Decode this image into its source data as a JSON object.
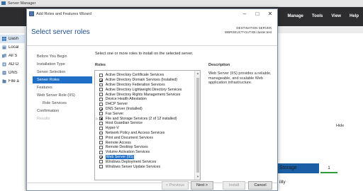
{
  "server_manager": {
    "title": "Server Manager",
    "menu": [
      "Manage",
      "Tools",
      "View",
      "Help"
    ],
    "sidebar": [
      {
        "label": "Dash",
        "icon": "dashboard-icon",
        "active": true
      },
      {
        "label": "Local",
        "icon": "server-icon"
      },
      {
        "label": "All S",
        "icon": "servers-icon"
      },
      {
        "label": "AD D",
        "icon": "ad-icon"
      },
      {
        "label": "DNS",
        "icon": "dns-icon"
      },
      {
        "label": "File a",
        "icon": "folder-icon"
      }
    ],
    "hide_label": "Hide",
    "storage_label": "Storage",
    "storage_count": "1",
    "lity_label": "ility"
  },
  "wizard": {
    "title": "Add Roles and Features Wizard",
    "heading": "Select server roles",
    "destination_label": "DESTINATION SERVER",
    "destination_server": "WBRSEUCTY1UTXB.cluster.test",
    "intro": "Select one or more roles to install on the selected server.",
    "roles_label": "Roles",
    "description_label": "Description",
    "description_text": "Web Server (IIS) provides a reliable, manageable, and scalable Web application infrastructure.",
    "nav": [
      {
        "label": "Before You Begin",
        "state": "normal"
      },
      {
        "label": "Installation Type",
        "state": "normal"
      },
      {
        "label": "Server Selection",
        "state": "normal"
      },
      {
        "label": "Server Roles",
        "state": "active"
      },
      {
        "label": "Features",
        "state": "normal"
      },
      {
        "label": "Web Server Role (IIS)",
        "state": "normal"
      },
      {
        "label": "Role Services",
        "state": "sub"
      },
      {
        "label": "Confirmation",
        "state": "normal"
      },
      {
        "label": "Results",
        "state": "disabled"
      }
    ],
    "roles": [
      {
        "label": "Active Directory Certificate Services",
        "state": "unchecked"
      },
      {
        "label": "Active Directory Domain Services (Installed)",
        "state": "checked"
      },
      {
        "label": "Active Directory Federation Services",
        "state": "unchecked"
      },
      {
        "label": "Active Directory Lightweight Directory Services",
        "state": "unchecked"
      },
      {
        "label": "Active Directory Rights Management Services",
        "state": "unchecked"
      },
      {
        "label": "Device Health Attestation",
        "state": "unchecked"
      },
      {
        "label": "DHCP Server",
        "state": "unchecked"
      },
      {
        "label": "DNS Server (Installed)",
        "state": "checked"
      },
      {
        "label": "Fax Server",
        "state": "unchecked"
      },
      {
        "label": "File and Storage Services (2 of 12 installed)",
        "state": "partial",
        "expandable": true
      },
      {
        "label": "Host Guardian Service",
        "state": "unchecked"
      },
      {
        "label": "Hyper-V",
        "state": "unchecked"
      },
      {
        "label": "Network Policy and Access Services",
        "state": "unchecked"
      },
      {
        "label": "Print and Document Services",
        "state": "unchecked"
      },
      {
        "label": "Remote Access",
        "state": "unchecked"
      },
      {
        "label": "Remote Desktop Services",
        "state": "unchecked"
      },
      {
        "label": "Volume Activation Services",
        "state": "unchecked"
      },
      {
        "label": "Web Server (IIS)",
        "state": "checked",
        "selected": true
      },
      {
        "label": "Windows Deployment Services",
        "state": "unchecked"
      },
      {
        "label": "Windows Server Update Services",
        "state": "unchecked"
      }
    ],
    "buttons": {
      "previous": "< Previous",
      "next": "Next >",
      "install": "Install",
      "cancel": "Cancel"
    }
  }
}
